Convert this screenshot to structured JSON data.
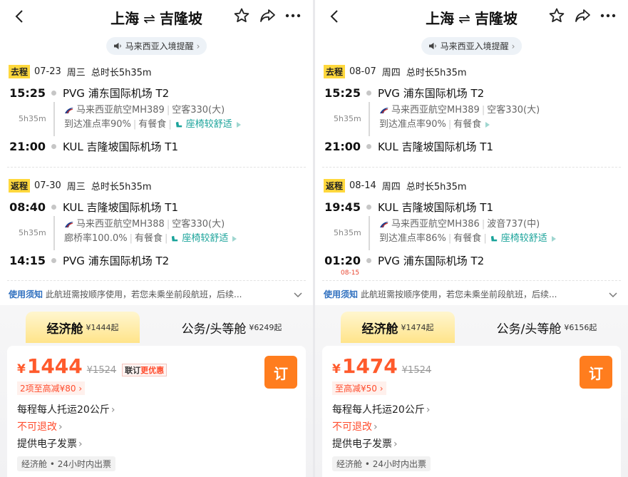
{
  "panels": [
    {
      "header": {
        "origin": "上海",
        "arrow": "⇌",
        "destination": "吉隆坡"
      },
      "notice": "马来西亚入境提醒",
      "outbound": {
        "tag": "去程",
        "date": "07-23",
        "weekday": "周三",
        "total": "总时长5h35m",
        "dep_time": "15:25",
        "dep_airport": "PVG 浦东国际机场 T2",
        "duration": "5h35m",
        "airline": "马来西亚航空MH389",
        "aircraft": "空客330(大)",
        "punctuality": "到达准点率90%",
        "meal": "有餐食",
        "comfort": "座椅较舒适",
        "arr_time": "21:00",
        "arr_airport": "KUL 吉隆坡国际机场 T1",
        "next_day": ""
      },
      "return": {
        "tag": "返程",
        "date": "07-30",
        "weekday": "周三",
        "total": "总时长5h35m",
        "dep_time": "08:40",
        "dep_airport": "KUL 吉隆坡国际机场 T1",
        "duration": "5h35m",
        "airline": "马来西亚航空MH388",
        "aircraft": "空客330(大)",
        "punctuality": "廊桥率100.0%",
        "meal": "有餐食",
        "comfort": "座椅较舒适",
        "arr_time": "14:15",
        "arr_airport": "PVG 浦东国际机场 T2",
        "next_day": ""
      },
      "rule": {
        "label": "使用须知",
        "text": "此航班需按顺序使用，若您未乘坐前段航班，后续..."
      },
      "cabins": {
        "economy": {
          "name": "经济舱",
          "price": "¥1444起"
        },
        "business": {
          "name": "公务/头等舱",
          "price": "¥6249起"
        }
      },
      "offer": {
        "currency": "¥",
        "price": "1444",
        "original": "¥1524",
        "promo_a": "联订",
        "promo_b": "更优惠",
        "reduce": "2项至高减¥80",
        "book": "订",
        "baggage": "每程每人托运20公斤",
        "refund": "不可退改",
        "invoice": "提供电子发票",
        "chip": "经济舱 • 24小时内出票"
      }
    },
    {
      "header": {
        "origin": "上海",
        "arrow": "⇌",
        "destination": "吉隆坡"
      },
      "notice": "马来西亚入境提醒",
      "outbound": {
        "tag": "去程",
        "date": "08-07",
        "weekday": "周四",
        "total": "总时长5h35m",
        "dep_time": "15:25",
        "dep_airport": "PVG 浦东国际机场 T2",
        "duration": "5h35m",
        "airline": "马来西亚航空MH389",
        "aircraft": "空客330(大)",
        "punctuality": "到达准点率90%",
        "meal": "有餐食",
        "comfort": "",
        "arr_time": "21:00",
        "arr_airport": "KUL 吉隆坡国际机场 T1",
        "next_day": ""
      },
      "return": {
        "tag": "返程",
        "date": "08-14",
        "weekday": "周四",
        "total": "总时长5h35m",
        "dep_time": "19:45",
        "dep_airport": "KUL 吉隆坡国际机场 T1",
        "duration": "5h35m",
        "airline": "马来西亚航空MH386",
        "aircraft": "波音737(中)",
        "punctuality": "到达准点率86%",
        "meal": "有餐食",
        "comfort": "座椅较舒适",
        "arr_time": "01:20",
        "arr_airport": "PVG 浦东国际机场 T2",
        "next_day": "08-15"
      },
      "rule": {
        "label": "使用须知",
        "text": "此航班需按顺序使用，若您未乘坐前段航班，后续..."
      },
      "cabins": {
        "economy": {
          "name": "经济舱",
          "price": "¥1474起"
        },
        "business": {
          "name": "公务/头等舱",
          "price": "¥6156起"
        }
      },
      "offer": {
        "currency": "¥",
        "price": "1474",
        "original": "¥1524",
        "promo_a": "",
        "promo_b": "",
        "reduce": "至高减¥50",
        "book": "订",
        "baggage": "每程每人托运20公斤",
        "refund": "不可退改",
        "invoice": "提供电子发票",
        "chip": "经济舱 • 24小时内出票"
      }
    }
  ],
  "colors": {
    "accent": "#ff5a2c",
    "book": "#ff7d1e",
    "tag": "#ffd83d",
    "comfort": "#1aa39a",
    "rule": "#2e6fbf"
  },
  "icons": [
    "back-arrow-icon",
    "star-icon",
    "share-icon",
    "more-icon",
    "speaker-icon",
    "airline-logo-icon",
    "seat-icon",
    "chevron-down-icon"
  ]
}
